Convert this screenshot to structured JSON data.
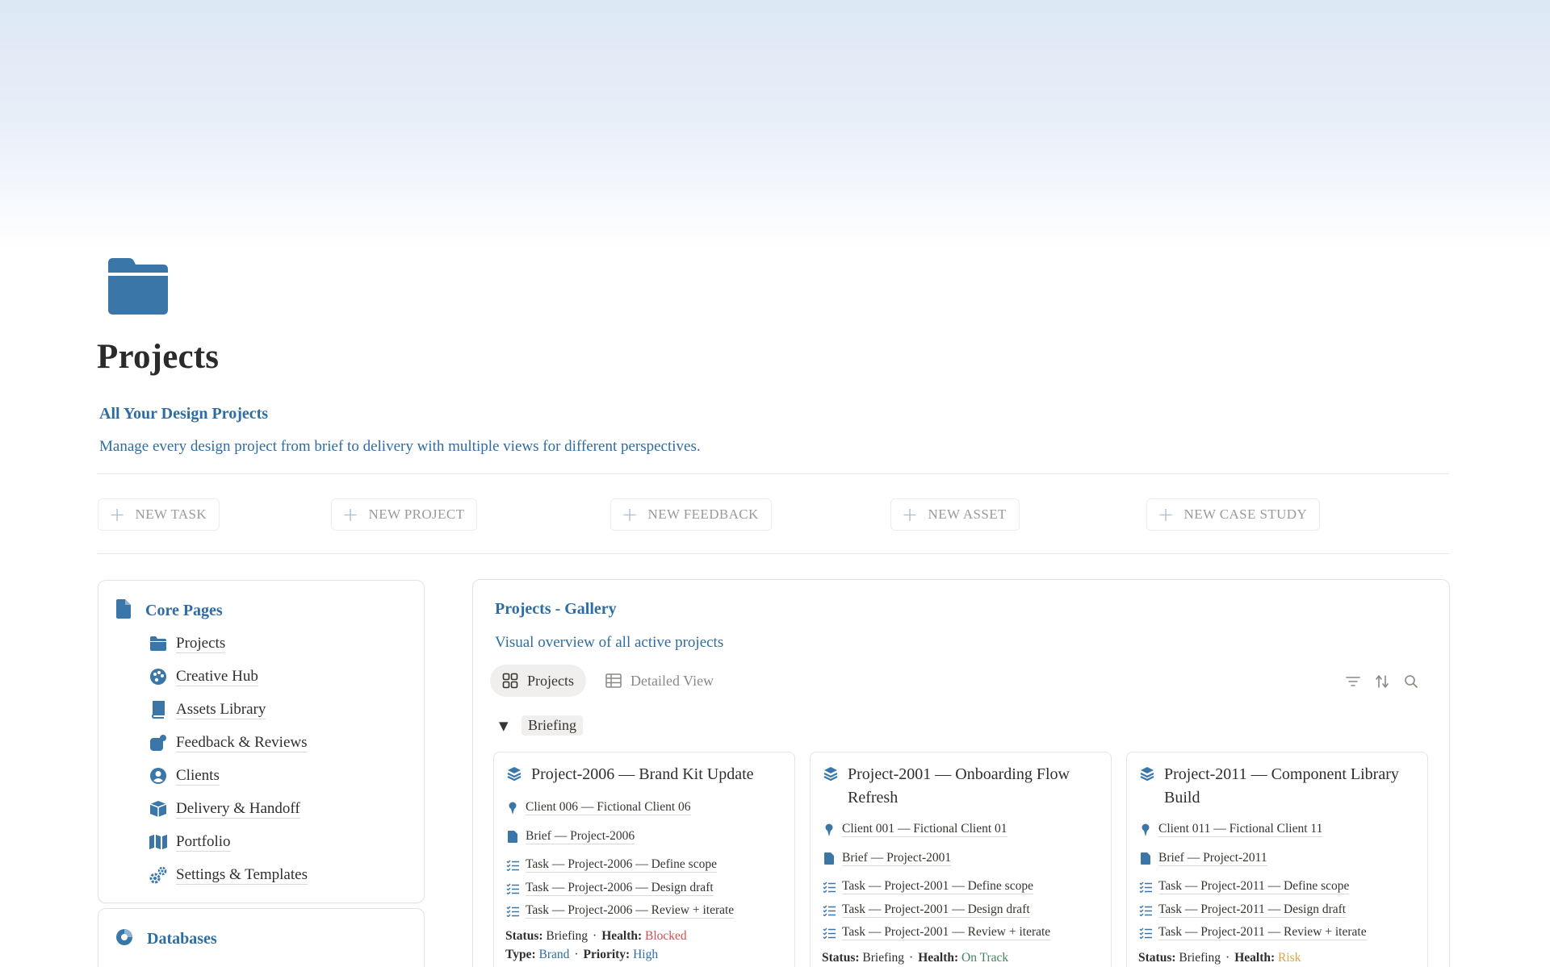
{
  "page": {
    "title": "Projects",
    "subtitle": "All Your Design Projects",
    "description": "Manage every design project from brief to delivery with multiple views for different perspectives.",
    "accent_color": "#2e6da4",
    "icon": "folder-icon"
  },
  "quick_actions": [
    {
      "label": "NEW TASK"
    },
    {
      "label": "NEW PROJECT"
    },
    {
      "label": "NEW FEEDBACK"
    },
    {
      "label": "NEW ASSET"
    },
    {
      "label": "NEW CASE STUDY"
    }
  ],
  "sidebar": {
    "core_title": "Core Pages",
    "items": [
      {
        "label": "Projects",
        "icon": "folder-icon"
      },
      {
        "label": "Creative Hub",
        "icon": "palette-icon"
      },
      {
        "label": "Assets Library",
        "icon": "book-icon"
      },
      {
        "label": "Feedback & Reviews",
        "icon": "comment-icon"
      },
      {
        "label": "Clients",
        "icon": "user-circle-icon"
      },
      {
        "label": "Delivery & Handoff",
        "icon": "package-icon"
      },
      {
        "label": "Portfolio",
        "icon": "map-icon"
      },
      {
        "label": "Settings & Templates",
        "icon": "gears-icon"
      }
    ],
    "databases_title": "Databases"
  },
  "gallery": {
    "title": "Projects - Gallery",
    "subtitle": "Visual overview of all active projects",
    "tabs": [
      {
        "label": "Projects",
        "active": true
      },
      {
        "label": "Detailed View",
        "active": false
      }
    ],
    "group": "Briefing",
    "cards": [
      {
        "title": "Project-2006 — Brand Kit Update",
        "client": "Client 006 — Fictional Client 06",
        "brief": "Brief — Project-2006",
        "tasks": [
          "Task — Project-2006 — Define scope",
          "Task — Project-2006 — Design draft",
          "Task — Project-2006 — Review + iterate"
        ],
        "status_label": "Status:",
        "status": "Briefing",
        "health_label": "Health:",
        "health": "Blocked",
        "type_label": "Type:",
        "type": "Brand",
        "priority_label": "Priority:",
        "priority": "High"
      },
      {
        "title": "Project-2001 — Onboarding Flow Refresh",
        "client": "Client 001 — Fictional Client 01",
        "brief": "Brief — Project-2001",
        "tasks": [
          "Task — Project-2001 — Define scope",
          "Task — Project-2001 — Design draft",
          "Task — Project-2001 — Review + iterate"
        ],
        "status_label": "Status:",
        "status": "Briefing",
        "health_label": "Health:",
        "health": "On Track"
      },
      {
        "title": "Project-2011 — Component Library Build",
        "client": "Client 011 — Fictional Client 11",
        "brief": "Brief — Project-2011",
        "tasks": [
          "Task — Project-2011 — Define scope",
          "Task — Project-2011 — Design draft",
          "Task — Project-2011 — Review + iterate"
        ],
        "status_label": "Status:",
        "status": "Briefing",
        "health_label": "Health:",
        "health": "Risk"
      }
    ]
  }
}
